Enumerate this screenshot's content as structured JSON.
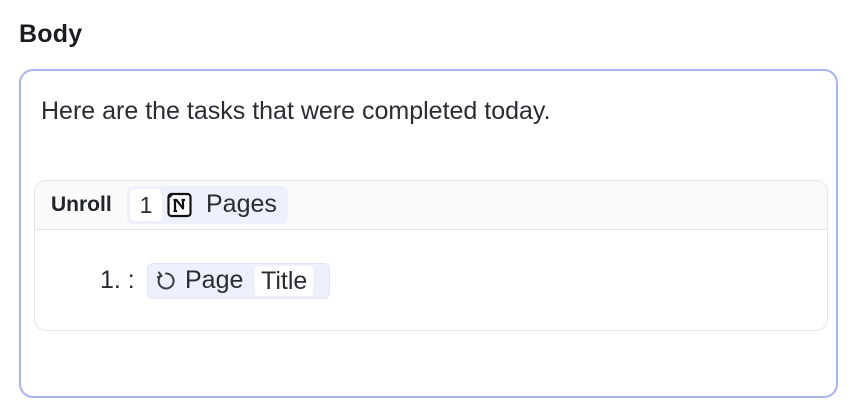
{
  "field": {
    "label": "Body"
  },
  "editor": {
    "text": "Here are the tasks that were completed today.",
    "unroll": {
      "label": "Unroll",
      "count": "1",
      "source_icon": "notion-icon",
      "source_label": "Pages",
      "items": [
        {
          "number": "1. :",
          "icon": "refresh-icon",
          "prefix": "Page",
          "field": "Title"
        }
      ]
    }
  },
  "colors": {
    "editor_border": "#a6b4f0",
    "chip_background": "#eef0fd",
    "block_border": "#e2e3e8"
  }
}
